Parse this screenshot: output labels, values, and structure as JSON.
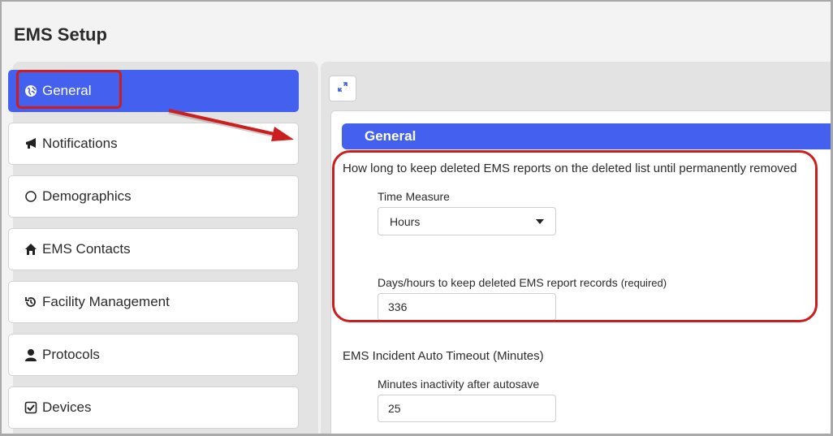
{
  "page": {
    "title": "EMS Setup"
  },
  "sidebar": {
    "items": [
      {
        "label": "General",
        "icon": "globe-icon",
        "active": true
      },
      {
        "label": "Notifications",
        "icon": "bullhorn-icon"
      },
      {
        "label": "Demographics",
        "icon": "circle-icon"
      },
      {
        "label": "EMS Contacts",
        "icon": "home-icon"
      },
      {
        "label": "Facility Management",
        "icon": "history-icon"
      },
      {
        "label": "Protocols",
        "icon": "user-icon"
      },
      {
        "label": "Devices",
        "icon": "check-square-icon"
      }
    ]
  },
  "panel": {
    "expand_icon": "expand-icon",
    "section_title": "General",
    "retention": {
      "question": "How long to keep deleted EMS reports on the deleted list until permanently removed",
      "time_measure_label": "Time Measure",
      "time_measure_value": "Hours",
      "days_label": "Days/hours to keep deleted EMS report records",
      "days_required": "(required)",
      "days_value": "336"
    },
    "timeout": {
      "question": "EMS Incident Auto Timeout (Minutes)",
      "minutes_label": "Minutes inactivity after autosave",
      "minutes_value": "25"
    }
  },
  "colors": {
    "accent": "#4361ee",
    "annotation": "#cc1e1e"
  }
}
